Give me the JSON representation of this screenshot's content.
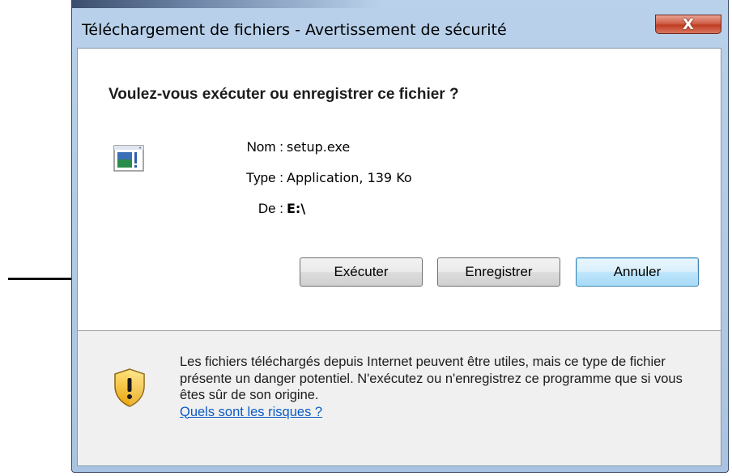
{
  "window": {
    "title": "Téléchargement de fichiers - Avertissement de sécurité",
    "close_glyph": "X"
  },
  "dialog": {
    "question": "Voulez-vous exécuter ou enregistrer ce fichier ?",
    "file": {
      "name_label": "Nom :",
      "name_value": "setup.exe",
      "type_label": "Type :",
      "type_value": "Application, 139 Ko",
      "from_label": "De :",
      "from_value": "E:\\"
    },
    "buttons": {
      "run": "Exécuter",
      "save": "Enregistrer",
      "cancel": "Annuler"
    },
    "warning_text": "Les fichiers téléchargés depuis Internet peuvent être utiles, mais ce type de fichier présente un danger potentiel. N'exécutez ou n'enregistrez ce programme que si vous êtes sûr de son origine.",
    "risk_link": "Quels sont les risques ?"
  },
  "icons": {
    "app": "application-icon",
    "shield": "security-shield-icon",
    "arrow": "pointer-arrow"
  },
  "colors": {
    "link": "#0b5bc7",
    "close_button": "#c13d24",
    "default_button_border": "#3c7fb1",
    "shield_yellow": "#f4c21b"
  }
}
